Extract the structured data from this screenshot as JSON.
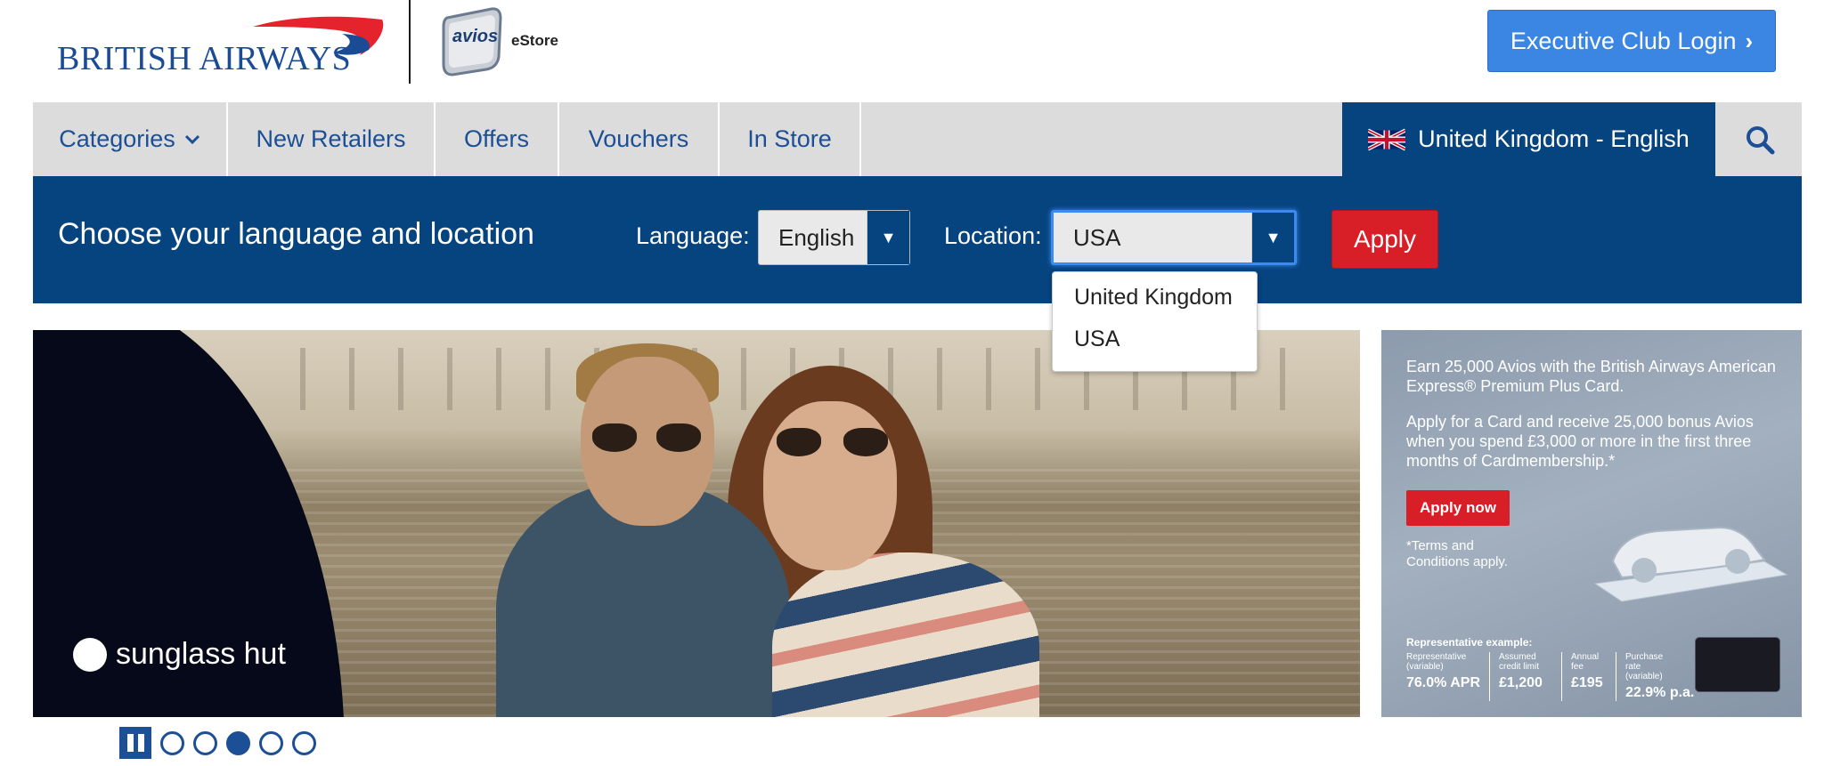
{
  "header": {
    "brand": "BRITISH AIRWAYS",
    "avios_logo_text": "avios",
    "estore_text": "eStore",
    "exec_login_label": "Executive Club Login",
    "exec_login_icon": "chevron-right-icon"
  },
  "nav": {
    "items": [
      {
        "label": "Categories",
        "icon": "chevron-down-icon"
      },
      {
        "label": "New Retailers"
      },
      {
        "label": "Offers"
      },
      {
        "label": "Vouchers"
      },
      {
        "label": "In Store"
      }
    ],
    "locale_label": "United Kingdom - English",
    "locale_icon": "uk-flag-icon",
    "search_icon": "search-icon"
  },
  "language_bar": {
    "title": "Choose your language and location",
    "language_label": "Language:",
    "language_value": "English",
    "location_label": "Location:",
    "location_value": "USA",
    "apply_label": "Apply",
    "location_options": [
      "United Kingdom",
      "USA"
    ]
  },
  "hero": {
    "brand_logo_text": "sunglass hut"
  },
  "ad": {
    "headline": "Earn 25,000 Avios with the British Airways American Express® Premium Plus Card.",
    "body": "Apply for a Card and receive 25,000 bonus Avios when you spend £3,000 or more in the first three months of Cardmembership.*",
    "apply_label": "Apply now",
    "terms": "*Terms and Conditions apply.",
    "rep_title": "Representative example:",
    "rep_items": [
      {
        "heading": "Representative (variable)",
        "value": "76.0% APR"
      },
      {
        "heading": "Assumed credit limit",
        "value": "£1,200"
      },
      {
        "heading": "Annual fee",
        "value": "£195"
      },
      {
        "heading": "Purchase rate (variable)",
        "value": "22.9% p.a."
      }
    ]
  },
  "carousel": {
    "pause_icon": "pause-icon",
    "slide_count": 5,
    "active_slide": 3
  },
  "colors": {
    "brand_blue": "#06447f",
    "link_blue": "#1c4f95",
    "button_blue": "#3a86e2",
    "apply_red": "#d81e27",
    "nav_grey": "#dcdcdc"
  }
}
